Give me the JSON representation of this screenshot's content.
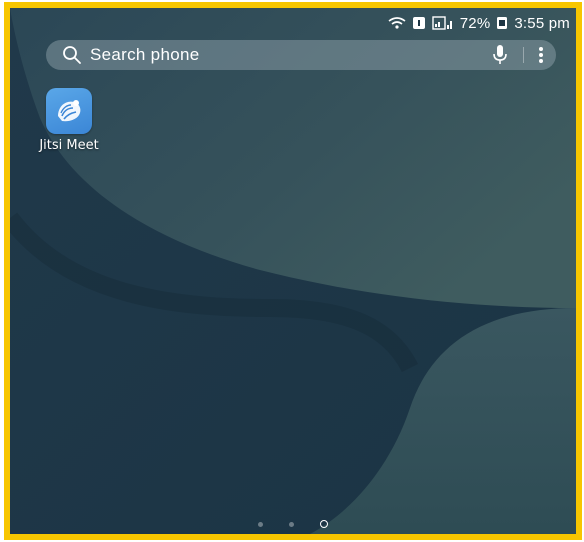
{
  "status_bar": {
    "battery_percent": "72%",
    "time": "3:55 pm",
    "icons": [
      "wifi-icon",
      "sim-badge-icon",
      "signal-icon",
      "battery-icon"
    ]
  },
  "search": {
    "placeholder": "Search phone",
    "icons": [
      "search-icon",
      "mic-icon",
      "more-vertical-icon"
    ]
  },
  "apps": [
    {
      "label": "Jitsi Meet",
      "icon": "jitsi-meet-app-icon",
      "color": "#4a97e0"
    }
  ],
  "page_indicator": {
    "pages": 3,
    "current": "home"
  },
  "colors": {
    "frame_border": "#f7c600",
    "wallpaper_dark": "#1a3240",
    "wallpaper_light": "#3d5a60"
  }
}
